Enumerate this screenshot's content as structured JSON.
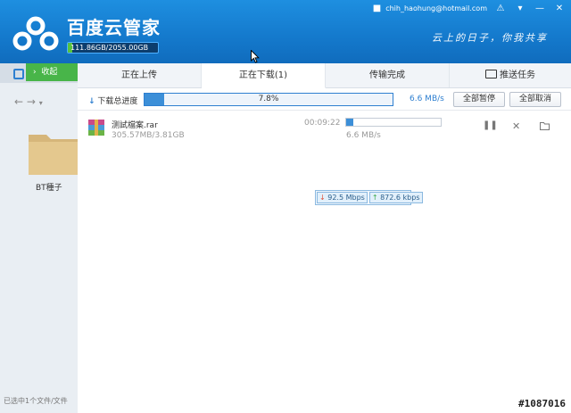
{
  "app": {
    "title": "百度云管家",
    "quota": "111.86GB/2055.00GB",
    "quota_fraction": 0.054,
    "user": "chih_haohung@hotmail.com",
    "slogan": "云上的日子，你我共享"
  },
  "left": {
    "collapse_label": "收起",
    "folder_label": "BT種子",
    "status": "已选中1个文件/文件"
  },
  "tabs": [
    {
      "label": "正在上传"
    },
    {
      "label": "正在下载(1)"
    },
    {
      "label": "传输完成"
    },
    {
      "label": "推送任务"
    }
  ],
  "summary": {
    "label": "下载总进度",
    "progress_text": "7.8%",
    "progress": 0.078,
    "speed": "6.6 MB/s",
    "pause_all": "全部暂停",
    "cancel_all": "全部取消"
  },
  "task": {
    "name": "测試檔案.rar",
    "size": "305.57MB/3.81GB",
    "eta": "00:09:22",
    "progress": 0.078,
    "speed": "6.6 MB/s"
  },
  "speed_badge": {
    "down": "92.5 Mbps",
    "up": "872.6 kbps"
  },
  "watermark": "#1087016"
}
